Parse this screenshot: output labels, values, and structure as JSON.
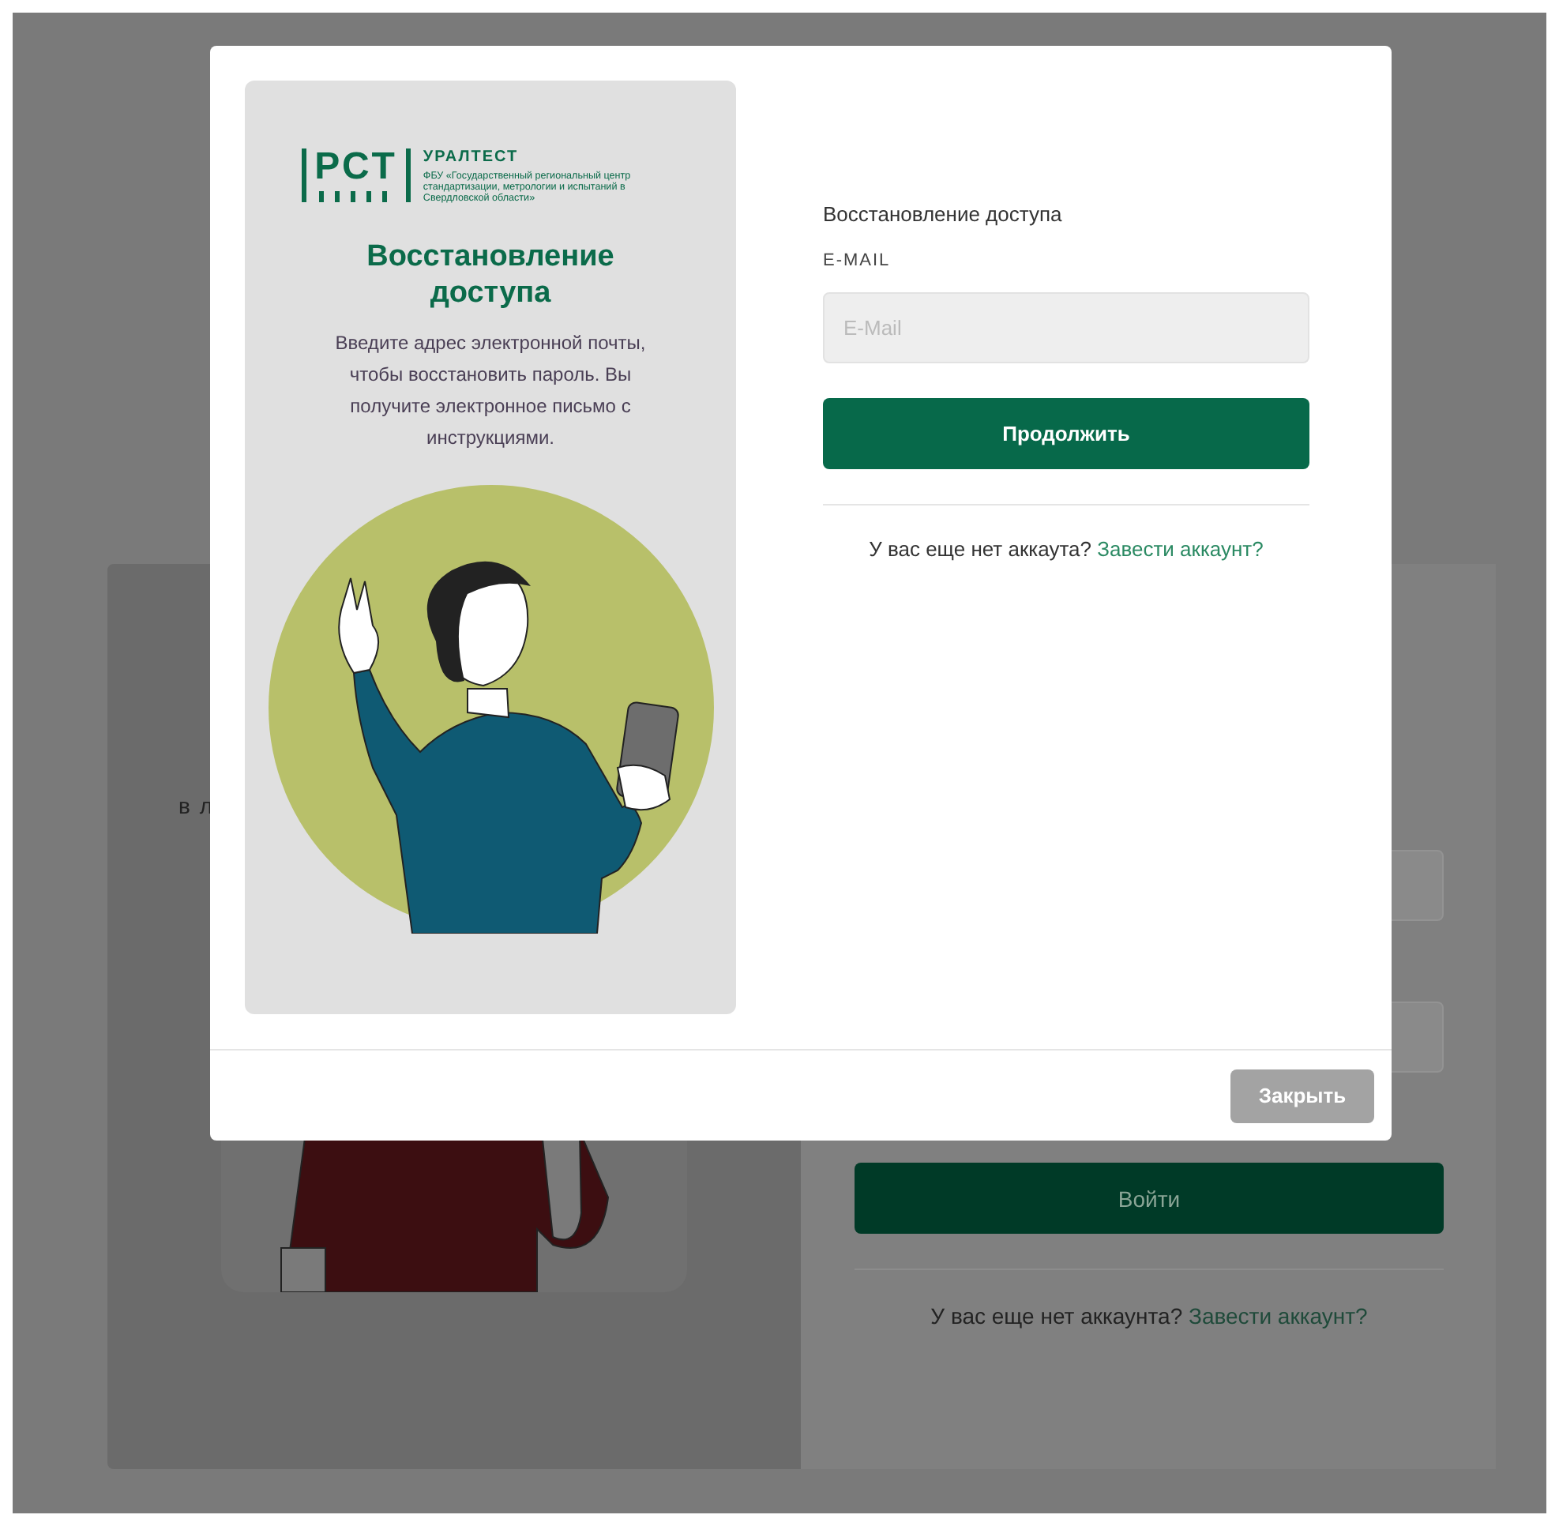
{
  "background_page": {
    "text_fragment": "в л",
    "login_button": "Войти",
    "signup_prompt": "У вас еще нет аккаунта?",
    "signup_link": "Завести аккаунт?"
  },
  "modal": {
    "logo": {
      "mark": "РСТ",
      "name": "УРАЛТЕСТ",
      "subtitle": "ФБУ «Государственный региональный центр стандартизации, метрологии и испытаний в Свердловской области»"
    },
    "panel_title": "Восстановление доступа",
    "panel_text": "Введите адрес электронной почты, чтобы восстановить пароль. Вы получите электронное письмо с инструкциями.",
    "form_title": "Восстановление доступа",
    "email_label": "E-MAIL",
    "email_field": {
      "placeholder": "E-Mail"
    },
    "submit_button": "Продолжить",
    "signup_prompt": "У вас еще нет аккаута?",
    "signup_link": "Завести аккаунт?",
    "close_button": "Закрыть"
  }
}
